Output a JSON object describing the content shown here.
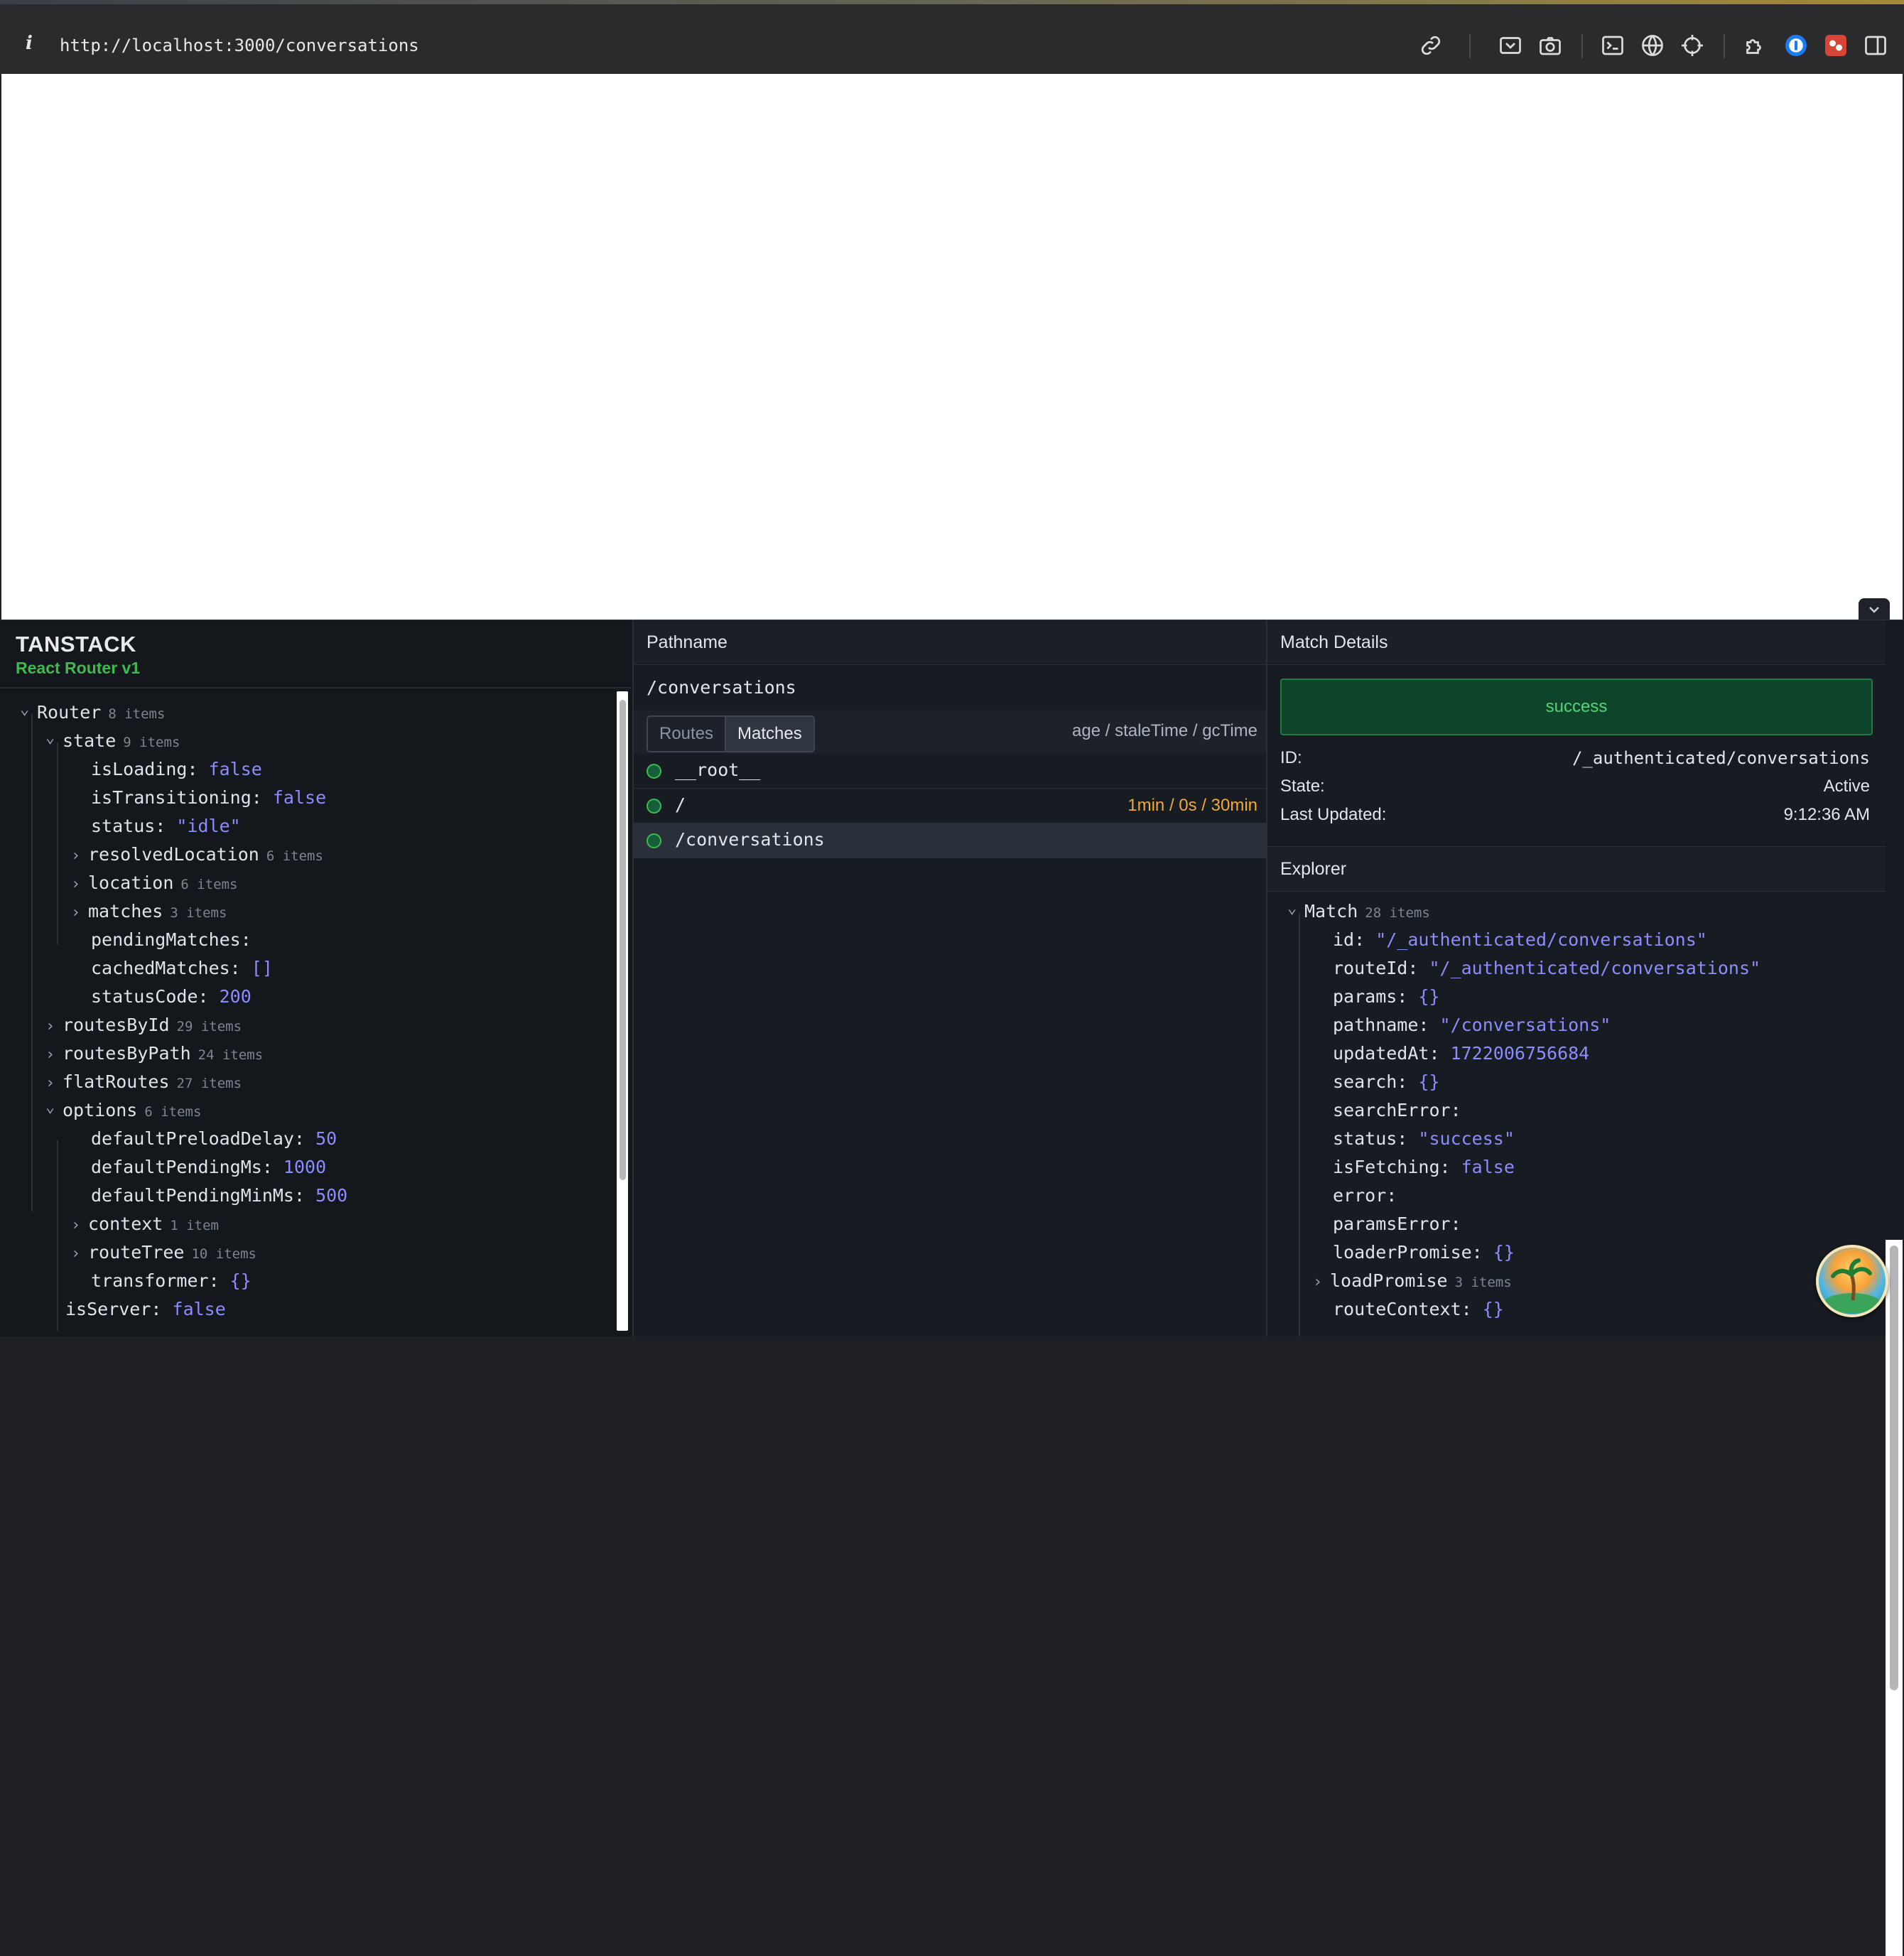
{
  "browser": {
    "url": "http://localhost:3000/conversations",
    "info_glyph": "i",
    "toolbar_icons": [
      "link-icon",
      "screenshot-area-icon",
      "camera-icon",
      "terminal-icon",
      "globe-icon",
      "crosshair-icon",
      "extensions-icon",
      "onepassword-icon",
      "extension-red-icon",
      "sidebar-icon"
    ]
  },
  "devtools": {
    "brand": {
      "title": "TANSTACK",
      "subtitle": "React Router v1"
    },
    "router_tree": [
      {
        "key": "Router",
        "count": "8 items",
        "expandable": true,
        "expanded": true,
        "depth": 0
      },
      {
        "key": "state",
        "count": "9 items",
        "expandable": true,
        "expanded": true,
        "depth": 1
      },
      {
        "key": "isLoading:",
        "value": "false",
        "depth": 2
      },
      {
        "key": "isTransitioning:",
        "value": "false",
        "depth": 2
      },
      {
        "key": "status:",
        "value": "\"idle\"",
        "depth": 2
      },
      {
        "key": "resolvedLocation",
        "count": "6 items",
        "expandable": true,
        "expanded": false,
        "depth": 2
      },
      {
        "key": "location",
        "count": "6 items",
        "expandable": true,
        "expanded": false,
        "depth": 2
      },
      {
        "key": "matches",
        "count": "3 items",
        "expandable": true,
        "expanded": false,
        "depth": 2
      },
      {
        "key": "pendingMatches:",
        "value": "",
        "depth": 2
      },
      {
        "key": "cachedMatches:",
        "value": "[]",
        "depth": 2
      },
      {
        "key": "statusCode:",
        "value": "200",
        "depth": 2
      },
      {
        "key": "routesById",
        "count": "29 items",
        "expandable": true,
        "expanded": false,
        "depth": 1
      },
      {
        "key": "routesByPath",
        "count": "24 items",
        "expandable": true,
        "expanded": false,
        "depth": 1
      },
      {
        "key": "flatRoutes",
        "count": "27 items",
        "expandable": true,
        "expanded": false,
        "depth": 1
      },
      {
        "key": "options",
        "count": "6 items",
        "expandable": true,
        "expanded": true,
        "depth": 1
      },
      {
        "key": "defaultPreloadDelay:",
        "value": "50",
        "depth": 2
      },
      {
        "key": "defaultPendingMs:",
        "value": "1000",
        "depth": 2
      },
      {
        "key": "defaultPendingMinMs:",
        "value": "500",
        "depth": 2
      },
      {
        "key": "context",
        "count": "1 item",
        "expandable": true,
        "expanded": false,
        "depth": 2
      },
      {
        "key": "routeTree",
        "count": "10 items",
        "expandable": true,
        "expanded": false,
        "depth": 2
      },
      {
        "key": "transformer:",
        "value": "{}",
        "depth": 2
      },
      {
        "key": "isServer:",
        "value": "false",
        "depth": 1
      }
    ],
    "middle": {
      "header": "Pathname",
      "pathname": "/conversations",
      "tabs": [
        {
          "label": "Routes",
          "active": false
        },
        {
          "label": "Matches",
          "active": true
        }
      ],
      "age_label": "age / staleTime / gcTime",
      "matches": [
        {
          "label": "__root__",
          "age": "",
          "selected": false
        },
        {
          "label": "/",
          "age": "1min / 0s / 30min",
          "selected": false
        },
        {
          "label": "/conversations",
          "age": "",
          "selected": true
        }
      ]
    },
    "right": {
      "header": "Match Details",
      "status": "success",
      "details": [
        {
          "label": "ID:",
          "value": "/_authenticated/conversations"
        },
        {
          "label": "State:",
          "value": "Active"
        },
        {
          "label": "Last Updated:",
          "value": "9:12:36 AM"
        }
      ],
      "explorer_header": "Explorer",
      "explorer_tree": [
        {
          "key": "Match",
          "count": "28 items",
          "expandable": true,
          "expanded": true,
          "depth": 0
        },
        {
          "key": "id:",
          "value": "\"/_authenticated/conversations\"",
          "depth": 1
        },
        {
          "key": "routeId:",
          "value": "\"/_authenticated/conversations\"",
          "depth": 1
        },
        {
          "key": "params:",
          "value": "{}",
          "depth": 1
        },
        {
          "key": "pathname:",
          "value": "\"/conversations\"",
          "depth": 1
        },
        {
          "key": "updatedAt:",
          "value": "1722006756684",
          "depth": 1
        },
        {
          "key": "search:",
          "value": "{}",
          "depth": 1
        },
        {
          "key": "searchError:",
          "value": "",
          "depth": 1
        },
        {
          "key": "status:",
          "value": "\"success\"",
          "depth": 1
        },
        {
          "key": "isFetching:",
          "value": "false",
          "depth": 1
        },
        {
          "key": "error:",
          "value": "",
          "depth": 1
        },
        {
          "key": "paramsError:",
          "value": "",
          "depth": 1
        },
        {
          "key": "loaderPromise:",
          "value": "{}",
          "depth": 1
        },
        {
          "key": "loadPromise",
          "count": "3 items",
          "expandable": true,
          "expanded": false,
          "depth": 1
        },
        {
          "key": "routeContext:",
          "value": "{}",
          "depth": 1
        }
      ]
    }
  },
  "colors": {
    "success_green": "#3fb950",
    "value_purple": "#8c8cff",
    "age_orange": "#f2a93b"
  }
}
